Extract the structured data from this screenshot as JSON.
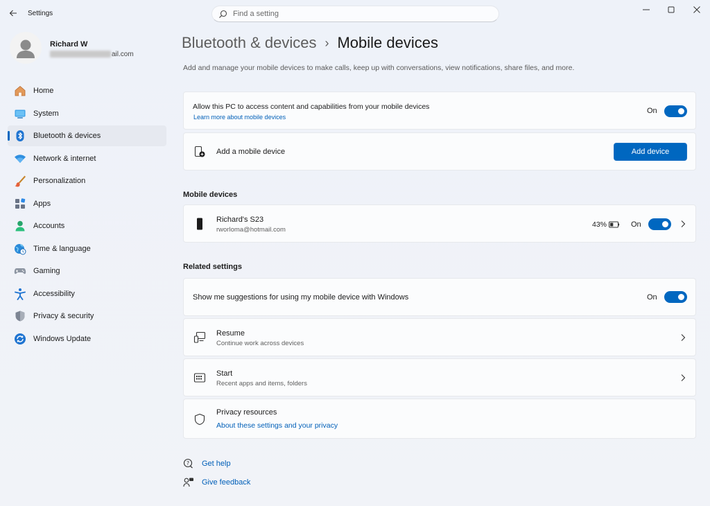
{
  "window": {
    "app_title": "Settings"
  },
  "search": {
    "placeholder": "Find a setting"
  },
  "profile": {
    "name": "Richard W",
    "email_suffix": "ail.com"
  },
  "sidebar": {
    "items": [
      {
        "label": "Home",
        "icon": "home-icon"
      },
      {
        "label": "System",
        "icon": "system-icon"
      },
      {
        "label": "Bluetooth & devices",
        "icon": "bluetooth-icon",
        "active": true
      },
      {
        "label": "Network & internet",
        "icon": "wifi-icon"
      },
      {
        "label": "Personalization",
        "icon": "brush-icon"
      },
      {
        "label": "Apps",
        "icon": "apps-icon"
      },
      {
        "label": "Accounts",
        "icon": "accounts-icon"
      },
      {
        "label": "Time & language",
        "icon": "globe-clock-icon"
      },
      {
        "label": "Gaming",
        "icon": "gamepad-icon"
      },
      {
        "label": "Accessibility",
        "icon": "accessibility-icon"
      },
      {
        "label": "Privacy & security",
        "icon": "shield-icon"
      },
      {
        "label": "Windows Update",
        "icon": "update-icon"
      }
    ]
  },
  "header": {
    "parent": "Bluetooth & devices",
    "separator": "›",
    "current": "Mobile devices",
    "description": "Add and manage your mobile devices to make calls, keep up with conversations, view notifications, share files, and more."
  },
  "access_card": {
    "title": "Allow this PC to access content and capabilities from your mobile devices",
    "link": "Learn more about mobile devices",
    "toggle_label": "On",
    "toggle_on": true
  },
  "add_card": {
    "title": "Add a mobile device",
    "button": "Add device"
  },
  "mobile_devices": {
    "section_title": "Mobile devices",
    "devices": [
      {
        "name": "Richard's S23",
        "account": "rworloma@hotmail.com",
        "battery": "43%",
        "battery_level": 0.43,
        "toggle_label": "On",
        "toggle_on": true
      }
    ]
  },
  "related": {
    "section_title": "Related settings",
    "suggestions": {
      "title": "Show me suggestions for using my mobile device with Windows",
      "toggle_label": "On",
      "toggle_on": true
    },
    "resume": {
      "title": "Resume",
      "subtitle": "Continue work across devices"
    },
    "start": {
      "title": "Start",
      "subtitle": "Recent apps and items, folders"
    },
    "privacy": {
      "title": "Privacy resources",
      "link": "About these settings and your privacy"
    }
  },
  "footer": {
    "get_help": "Get help",
    "give_feedback": "Give feedback"
  },
  "colors": {
    "accent": "#0067c0",
    "link": "#005fb8"
  }
}
